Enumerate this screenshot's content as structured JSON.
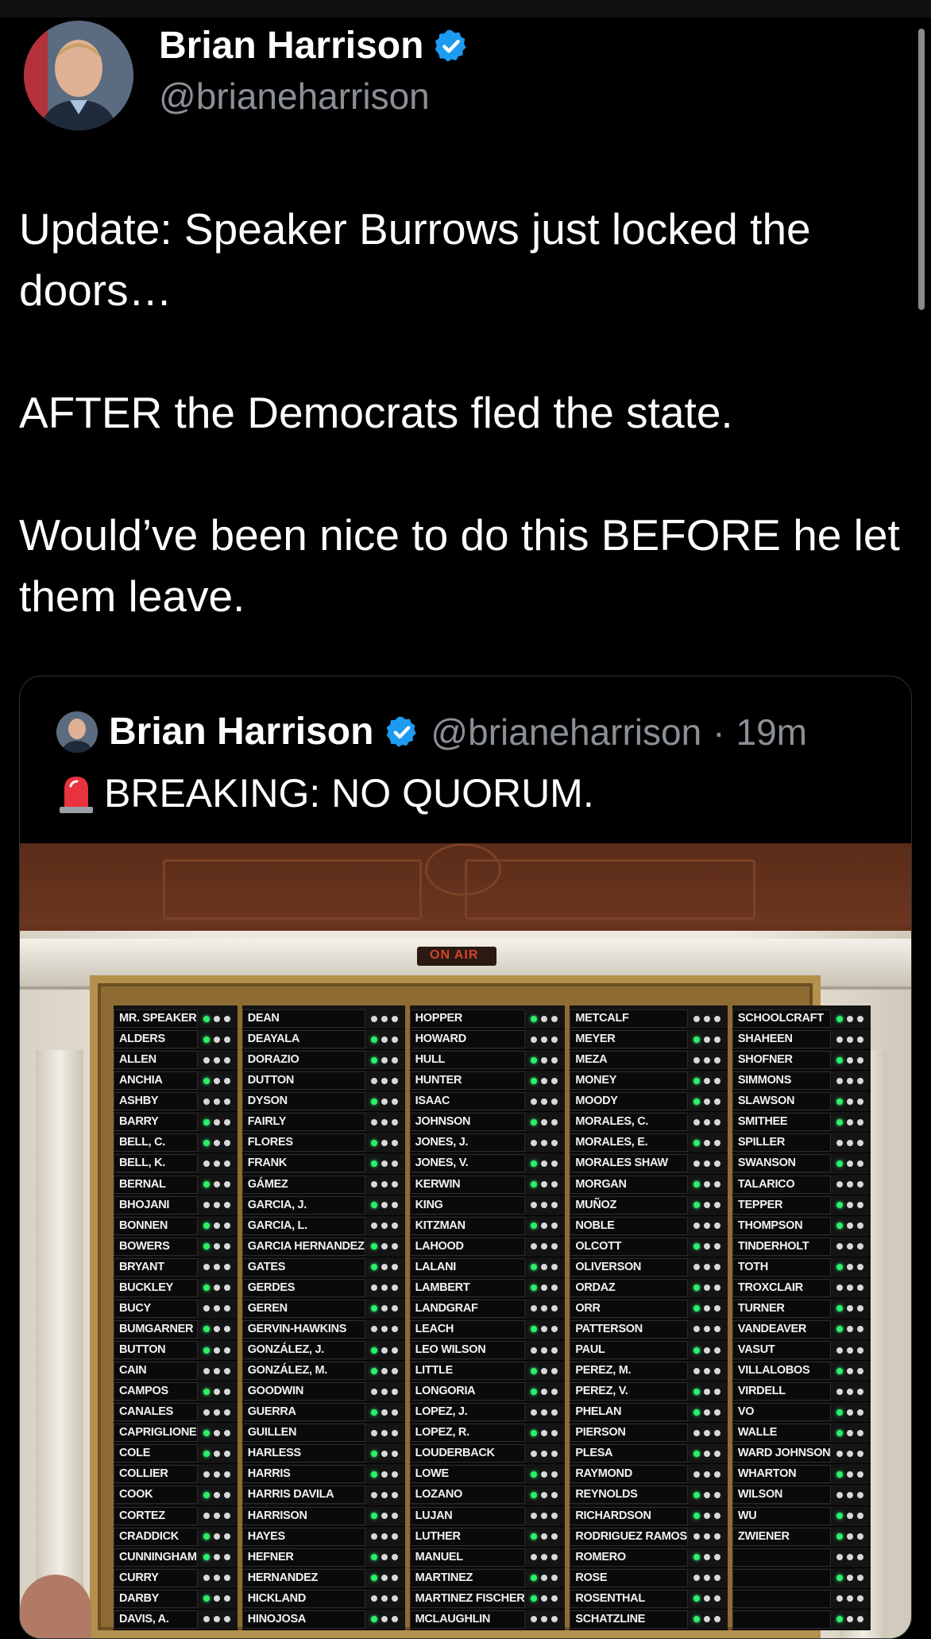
{
  "author": {
    "name": "Brian Harrison",
    "handle": "@brianeharrison",
    "verified_color": "#1d9bf0"
  },
  "tweet": {
    "paragraphs": [
      "Update: Speaker Burrows just locked the doors…",
      "AFTER the Democrats fled the state.",
      "Would’ve been nice to do this BEFORE he let them leave."
    ]
  },
  "quoted": {
    "name": "Brian Harrison",
    "handle": "@brianeharrison",
    "separator": "·",
    "time": "19m",
    "text": "BREAKING:  NO QUORUM.",
    "emoji_icon": "police-siren-icon",
    "photo_alt_sign": "ON AIR",
    "board_columns": [
      [
        "MR. SPEAKER",
        "ALDERS",
        "ALLEN",
        "ANCHIA",
        "ASHBY",
        "BARRY",
        "BELL, C.",
        "BELL, K.",
        "BERNAL",
        "BHOJANI",
        "BONNEN",
        "BOWERS",
        "BRYANT",
        "BUCKLEY",
        "BUCY",
        "BUMGARNER",
        "BUTTON",
        "CAIN",
        "CAMPOS",
        "CANALES",
        "CAPRIGLIONE",
        "COLE",
        "COLLIER",
        "COOK",
        "CORTEZ",
        "CRADDICK",
        "CUNNINGHAM",
        "CURRY",
        "DARBY",
        "DAVIS, A."
      ],
      [
        "DEAN",
        "DEAYALA",
        "DORAZIO",
        "DUTTON",
        "DYSON",
        "FAIRLY",
        "FLORES",
        "FRANK",
        "GÁMEZ",
        "GARCIA, J.",
        "GARCIA, L.",
        "GARCIA HERNANDEZ",
        "GATES",
        "GERDES",
        "GEREN",
        "GERVIN-HAWKINS",
        "GONZÁLEZ, J.",
        "GONZÁLEZ, M.",
        "GOODWIN",
        "GUERRA",
        "GUILLEN",
        "HARLESS",
        "HARRIS",
        "HARRIS DAVILA",
        "HARRISON",
        "HAYES",
        "HEFNER",
        "HERNANDEZ",
        "HICKLAND",
        "HINOJOSA"
      ],
      [
        "HOPPER",
        "HOWARD",
        "HULL",
        "HUNTER",
        "ISAAC",
        "JOHNSON",
        "JONES, J.",
        "JONES, V.",
        "KERWIN",
        "KING",
        "KITZMAN",
        "LAHOOD",
        "LALANI",
        "LAMBERT",
        "LANDGRAF",
        "LEACH",
        "LEO WILSON",
        "LITTLE",
        "LONGORIA",
        "LOPEZ, J.",
        "LOPEZ, R.",
        "LOUDERBACK",
        "LOWE",
        "LOZANO",
        "LUJAN",
        "LUTHER",
        "MANUEL",
        "MARTINEZ",
        "MARTINEZ FISCHER",
        "MCLAUGHLIN"
      ],
      [
        "METCALF",
        "MEYER",
        "MEZA",
        "MONEY",
        "MOODY",
        "MORALES, C.",
        "MORALES, E.",
        "MORALES SHAW",
        "MORGAN",
        "MUÑOZ",
        "NOBLE",
        "OLCOTT",
        "OLIVERSON",
        "ORDAZ",
        "ORR",
        "PATTERSON",
        "PAUL",
        "PEREZ, M.",
        "PEREZ, V.",
        "PHELAN",
        "PIERSON",
        "PLESA",
        "RAYMOND",
        "REYNOLDS",
        "RICHARDSON",
        "RODRIGUEZ RAMOS",
        "ROMERO",
        "ROSE",
        "ROSENTHAL",
        "SCHATZLINE"
      ],
      [
        "SCHOOLCRAFT",
        "SHAHEEN",
        "SHOFNER",
        "SIMMONS",
        "SLAWSON",
        "SMITHEE",
        "SPILLER",
        "SWANSON",
        "TALARICO",
        "TEPPER",
        "THOMPSON",
        "TINDERHOLT",
        "TOTH",
        "TROXCLAIR",
        "TURNER",
        "VANDEAVER",
        "VASUT",
        "VILLALOBOS",
        "VIRDELL",
        "VO",
        "WALLE",
        "WARD JOHNSON",
        "WHARTON",
        "WILSON",
        "WU",
        "ZWIENER",
        "",
        "",
        "",
        ""
      ]
    ]
  }
}
